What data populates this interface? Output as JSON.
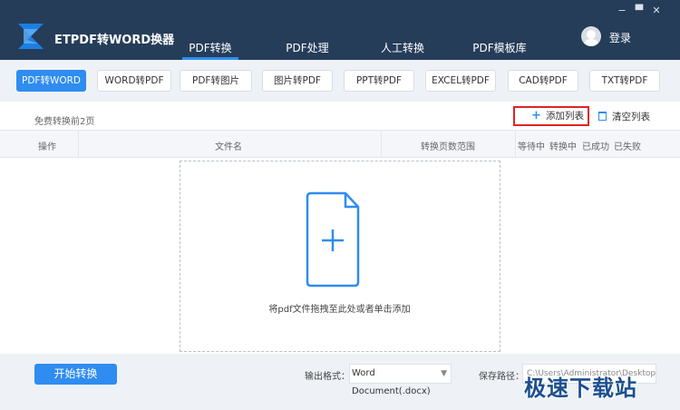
{
  "app": {
    "title": "ETPDF转WORD换器"
  },
  "nav": {
    "tabs": [
      {
        "label": "PDF转换"
      },
      {
        "label": "PDF处理"
      },
      {
        "label": "人工转换"
      },
      {
        "label": "PDF模板库"
      }
    ]
  },
  "window": {
    "minimize": "−",
    "maximize": "▀",
    "close": "✕"
  },
  "user": {
    "login_label": "登录"
  },
  "toolbar": {
    "buttons": [
      {
        "label": "PDF转WORD"
      },
      {
        "label": "WORD转PDF"
      },
      {
        "label": "PDF转图片"
      },
      {
        "label": "图片转PDF"
      },
      {
        "label": "PPT转PDF"
      },
      {
        "label": "EXCEL转PDF"
      },
      {
        "label": "CAD转PDF"
      },
      {
        "label": "TXT转PDF"
      }
    ]
  },
  "main": {
    "free_note": "免费转换前2页",
    "add_list_label": "添加列表",
    "clear_list_label": "清空列表",
    "columns": {
      "action": "操作",
      "filename": "文件名",
      "page_range": "转换页数范围",
      "waiting": "等待中",
      "converting": "转换中",
      "success": "已成功",
      "failed": "已失败"
    },
    "drop_text": "将pdf文件拖拽至此处或者单击添加"
  },
  "bottom": {
    "start_label": "开始转换",
    "output_format_label": "输出格式：",
    "output_format_value": "Word Document(.docx)",
    "save_path_label": "保存路径：",
    "save_path_value": "C:\\Users\\Administrator\\Desktop\\PDF转WORD"
  },
  "watermark": "极速下载站",
  "colors": {
    "titlebar": "#253d59",
    "accent": "#2f8cf0",
    "highlight_box": "#e02424"
  }
}
